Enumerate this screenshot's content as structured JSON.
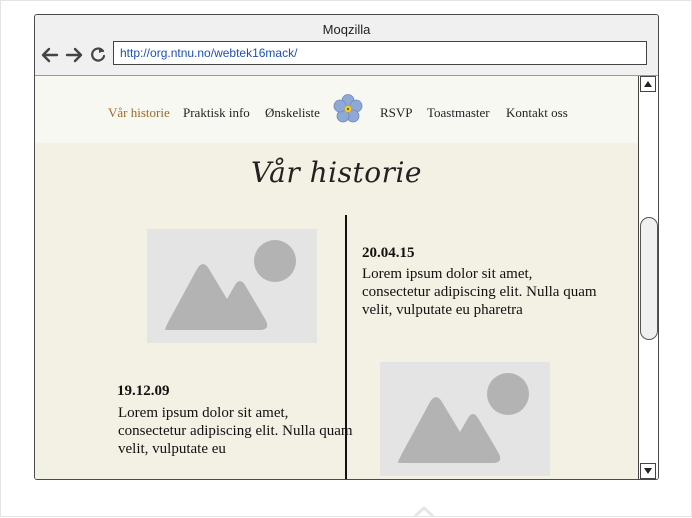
{
  "window": {
    "title": "Moqzilla"
  },
  "toolbar": {
    "back_icon": "arrow-left-icon",
    "forward_icon": "arrow-right-icon",
    "reload_icon": "reload-icon",
    "url": "http://org.ntnu.no/webtek16mack/"
  },
  "nav": {
    "items": [
      {
        "label": "Vår historie",
        "active": true
      },
      {
        "label": "Praktisk info"
      },
      {
        "label": "Ønskeliste"
      },
      {
        "label": "RSVP"
      },
      {
        "label": "Toastmaster"
      },
      {
        "label": "Kontakt oss"
      }
    ],
    "logo_icon": "forget-me-not-flower-icon"
  },
  "page": {
    "title": "Vår historie",
    "entries": [
      {
        "date": "20.04.15",
        "text": "Lorem ipsum dolor sit amet, consectetur adipiscing elit. Nulla quam velit, vulputate eu pharetra"
      },
      {
        "date": "19.12.09",
        "text": "Lorem ipsum dolor sit amet, consectetur adipiscing elit. Nulla quam velit, vulputate eu"
      }
    ]
  },
  "colors": {
    "active_nav": "#9a6a2c",
    "page_background": "#f2f1e3",
    "nav_background": "#f8f8f3",
    "url_text": "#1f4fb5"
  }
}
